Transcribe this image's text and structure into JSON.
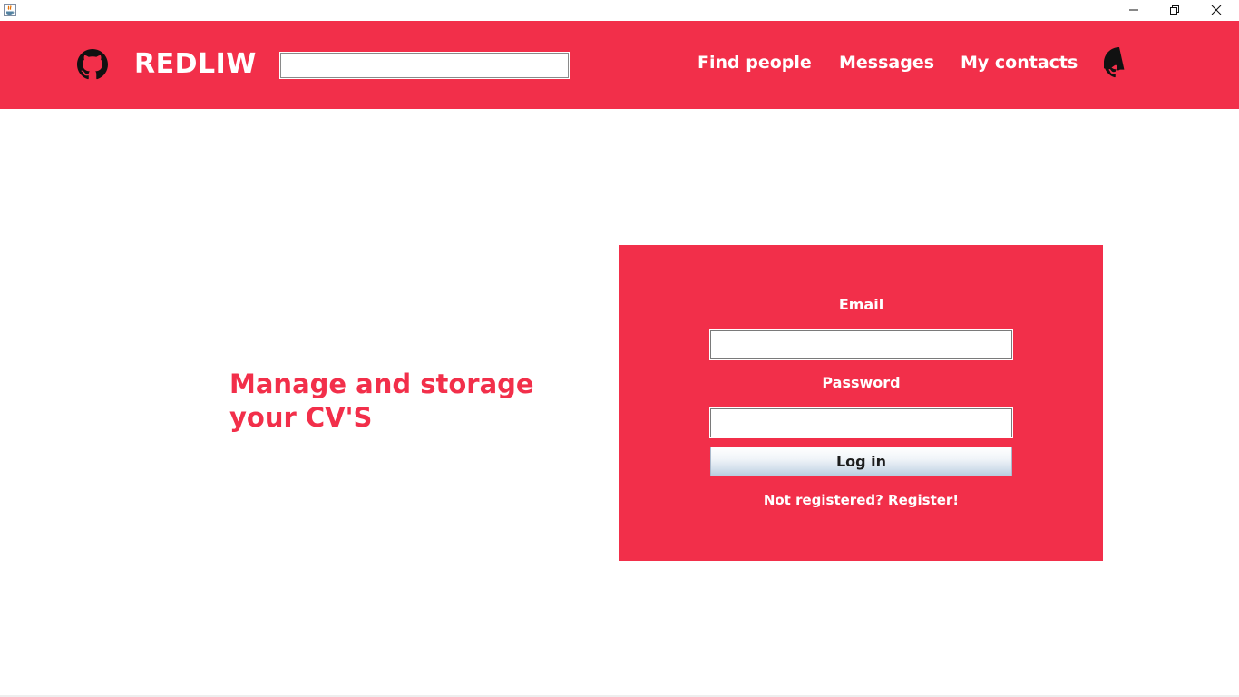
{
  "window": {
    "app_icon": "java-icon",
    "controls": {
      "minimize_icon": "minimize-icon",
      "maximize_icon": "restore-icon",
      "close_icon": "close-icon"
    }
  },
  "theme": {
    "accent": "#f22f4a",
    "text_on_accent": "#ffffff"
  },
  "header": {
    "brand": "REDLIW",
    "left_icon": "github-icon",
    "right_icon": "github-icon",
    "search": {
      "value": "",
      "placeholder": ""
    },
    "nav": {
      "find_people": "Find people",
      "messages": "Messages",
      "my_contacts": "My contacts"
    }
  },
  "main": {
    "tagline_line1": "Manage and storage",
    "tagline_line2": "your CV'S"
  },
  "login": {
    "email_label": "Email",
    "email_value": "",
    "password_label": "Password",
    "password_value": "",
    "login_button": "Log in",
    "register_link": "Not registered? Register!"
  }
}
